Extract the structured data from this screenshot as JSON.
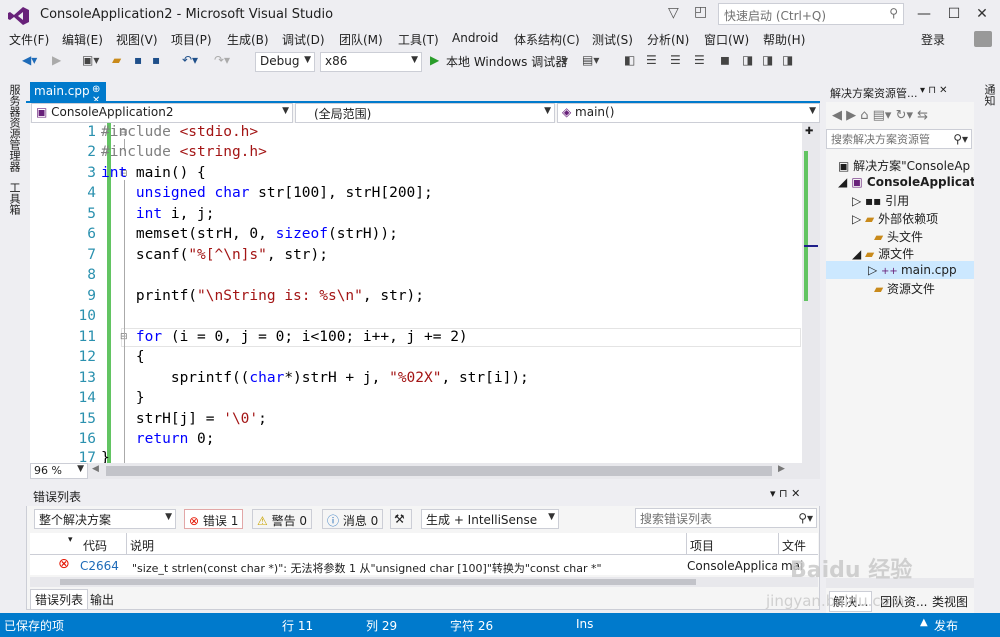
{
  "window": {
    "title": "ConsoleApplication2 - Microsoft Visual Studio",
    "quick_launch_placeholder": "快速启动 (Ctrl+Q)"
  },
  "menus": [
    "文件(F)",
    "编辑(E)",
    "视图(V)",
    "项目(P)",
    "生成(B)",
    "调试(D)",
    "团队(M)",
    "工具(T)",
    "Android",
    "体系结构(C)",
    "测试(S)",
    "分析(N)",
    "窗口(W)",
    "帮助(H)"
  ],
  "login": "登录",
  "toolbar": {
    "config": "Debug",
    "platform": "x86",
    "run_label": "本地 Windows 调试器"
  },
  "left_tabs": [
    "服务器资源管理器",
    "工具箱"
  ],
  "right_tab": "通知",
  "editor": {
    "tab": "main.cpp",
    "nav_project": "ConsoleApplication2",
    "nav_scope": "(全局范围)",
    "nav_func": "main()",
    "zoom": "96 %",
    "line_numbers": [
      "1",
      "2",
      "3",
      "4",
      "5",
      "6",
      "7",
      "8",
      "9",
      "10",
      "11",
      "12",
      "13",
      "14",
      "15",
      "16",
      "17"
    ]
  },
  "error_list": {
    "title": "错误列表",
    "scope": "整个解决方案",
    "errors_btn": "错误 1",
    "warnings_btn": "警告 0",
    "messages_btn": "消息 0",
    "build_filter": "生成 + IntelliSense",
    "search_placeholder": "搜索错误列表",
    "col_code": "代码",
    "col_desc": "说明",
    "col_project": "项目",
    "col_file": "文件",
    "row_code": "C2664",
    "row_desc": "\"size_t strlen(const char *)\": 无法将参数 1 从\"unsigned char [100]\"转换为\"const char *\"",
    "row_project": "ConsoleApplicati",
    "row_file": "mai",
    "tab1": "错误列表",
    "tab2": "输出"
  },
  "solution_explorer": {
    "title": "解决方案资源管...",
    "search_placeholder": "搜索解决方案资源管",
    "solution": "解决方案\"ConsoleAp",
    "project": "ConsoleApplicati",
    "items": [
      "引用",
      "外部依赖项",
      "头文件",
      "源文件",
      "main.cpp",
      "资源文件"
    ],
    "bottom_tabs": [
      "解决...",
      "团队资...",
      "类视图"
    ]
  },
  "status": {
    "saved": "已保存的项",
    "line": "行 11",
    "col": "列 29",
    "char": "字符 26",
    "ins": "Ins",
    "publish": "发布"
  },
  "watermark": {
    "brand": "Baidu 经验",
    "url": "jingyan.baidu.com"
  },
  "colors": {
    "accent": "#007acc",
    "keyword": "#0000ff",
    "string": "#a31515",
    "line_number": "#2b91af",
    "error": "#e51400"
  }
}
